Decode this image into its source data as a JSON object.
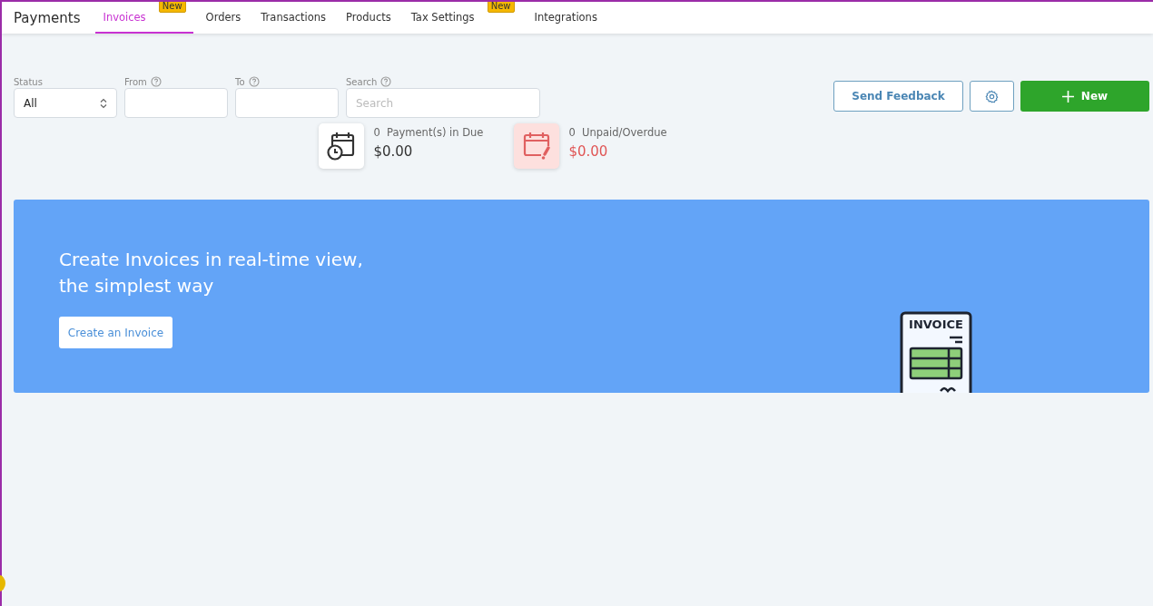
{
  "header": {
    "title": "Payments",
    "tabs": [
      {
        "label": "Invoices",
        "selected": true,
        "badge": "New"
      },
      {
        "label": "Orders",
        "selected": false
      },
      {
        "label": "Transactions",
        "selected": false
      },
      {
        "label": "Products",
        "selected": false
      },
      {
        "label": "Tax Settings",
        "selected": false,
        "badge": "New"
      },
      {
        "label": "Integrations",
        "selected": false
      }
    ]
  },
  "filters": [
    {
      "kind": "select",
      "label": "Status",
      "value": "All"
    },
    {
      "kind": "date",
      "label": "From",
      "help": true
    },
    {
      "kind": "date",
      "label": "To",
      "help": true
    },
    {
      "kind": "search",
      "label": "Search",
      "help": true,
      "placeholder": "Search"
    }
  ],
  "actions": {
    "feedback": "Send Feedback",
    "new": "New"
  },
  "stats": [
    {
      "kind": "due",
      "count": "0",
      "label": "Payment(s) in Due",
      "amount": "$0.00"
    },
    {
      "kind": "overdue",
      "count": "0",
      "label": "Unpaid/Overdue",
      "amount": "$0.00"
    }
  ],
  "banner": {
    "lines": [
      "Create Invoices in real-time view,",
      "the simplest way"
    ],
    "button": "Create an Invoice",
    "illustration_label": "INVOICE"
  }
}
